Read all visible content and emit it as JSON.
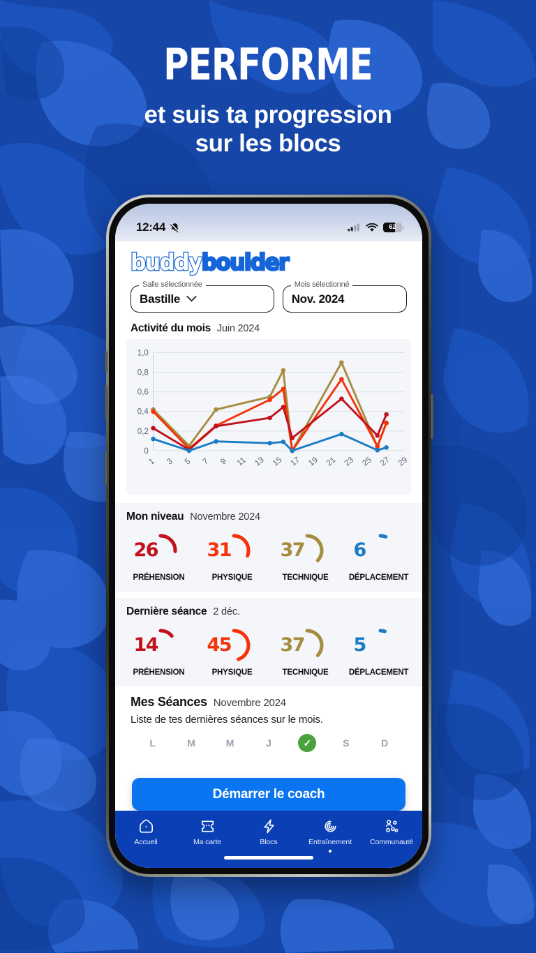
{
  "promo": {
    "headline": "PERFORME",
    "subhead_line1": "et suis ta progression",
    "subhead_line2": "sur les blocs",
    "background_color": "#1546a8"
  },
  "status_bar": {
    "time": "12:44",
    "bell_icon": "bell-muted-icon",
    "cellular_icon": "cellular-signal-icon",
    "wifi_icon": "wifi-icon",
    "battery_percent": "62"
  },
  "app": {
    "logo_part1": "buddy",
    "logo_part2": "boulder",
    "brand_color": "#1565d8",
    "selectors": [
      {
        "label": "Salle sélectionnée",
        "value": "Bastille",
        "has_chevron": true
      },
      {
        "label": "Mois sélectionné",
        "value": "Nov. 2024",
        "has_chevron": false
      }
    ],
    "activity": {
      "title": "Activité du mois",
      "subtitle": "Juin 2024"
    },
    "level": {
      "title": "Mon niveau",
      "subtitle": "Novembre 2024",
      "metrics": [
        {
          "label": "PRÉHENSION",
          "value": "26",
          "color": "#c1121c",
          "pct": 26
        },
        {
          "label": "PHYSIQUE",
          "value": "31",
          "color": "#f53209",
          "pct": 31
        },
        {
          "label": "TECHNIQUE",
          "value": "37",
          "color": "#a68c3f",
          "pct": 37
        },
        {
          "label": "DÉPLACEMENT",
          "value": "6",
          "color": "#1a7cc4",
          "pct": 6
        }
      ]
    },
    "last_session": {
      "title": "Dernière séance",
      "subtitle": "2 déc.",
      "metrics": [
        {
          "label": "PRÉHENSION",
          "value": "14",
          "color": "#c1121c",
          "pct": 14
        },
        {
          "label": "PHYSIQUE",
          "value": "45",
          "color": "#f53209",
          "pct": 45
        },
        {
          "label": "TECHNIQUE",
          "value": "37",
          "color": "#a68c3f",
          "pct": 37
        },
        {
          "label": "DÉPLACEMENT",
          "value": "5",
          "color": "#1a7cc4",
          "pct": 5
        }
      ]
    },
    "sessions": {
      "title": "Mes Séances",
      "subtitle": "Novembre 2024",
      "description": "Liste de tes dernières séances sur le mois.",
      "weekdays": [
        {
          "letter": "L",
          "done": false
        },
        {
          "letter": "M",
          "done": false
        },
        {
          "letter": "M",
          "done": false
        },
        {
          "letter": "J",
          "done": false
        },
        {
          "letter": "✓",
          "done": true
        },
        {
          "letter": "S",
          "done": false
        },
        {
          "letter": "D",
          "done": false
        }
      ]
    },
    "cta_label": "Démarrer le coach",
    "cta_color": "#0b74f0",
    "nav": {
      "background_color": "#0b3fb5",
      "items": [
        {
          "label": "Accueil",
          "icon": "home-icon"
        },
        {
          "label": "Ma carte",
          "icon": "card-icon"
        },
        {
          "label": "Blocs",
          "icon": "bolt-icon"
        },
        {
          "label": "Entraînement",
          "icon": "spiral-icon",
          "active": true
        },
        {
          "label": "Communauté",
          "icon": "community-icon"
        }
      ]
    }
  },
  "chart_data": {
    "type": "line",
    "title": "Activité du mois",
    "subtitle": "Juin 2024",
    "xlabel": "",
    "ylabel": "",
    "ylim": [
      0,
      1.0
    ],
    "yticks": [
      "0",
      "0,2",
      "0,4",
      "0,6",
      "0,8",
      "1,0"
    ],
    "grid": true,
    "legend_position": "none",
    "x": [
      1,
      5,
      8,
      14,
      15.5,
      16.5,
      22,
      26,
      27
    ],
    "xticks": [
      "1",
      "3",
      "5",
      "7",
      "9",
      "11",
      "13",
      "15",
      "17",
      "19",
      "21",
      "23",
      "25",
      "27",
      "29"
    ],
    "xlim": [
      1,
      29
    ],
    "series": [
      {
        "name": "Technique",
        "color": "#a68c3f",
        "values": [
          0.42,
          0.05,
          0.42,
          0.55,
          0.82,
          0.0,
          0.9,
          0.04,
          0.28
        ]
      },
      {
        "name": "Physique",
        "color": "#f53209",
        "values": [
          0.4,
          0.02,
          0.255,
          0.52,
          0.63,
          0.0,
          0.73,
          0.045,
          0.285
        ]
      },
      {
        "name": "Préhension",
        "color": "#c1121c",
        "values": [
          0.23,
          0.01,
          0.25,
          0.335,
          0.445,
          0.13,
          0.53,
          0.155,
          0.37
        ]
      },
      {
        "name": "Déplacement",
        "color": "#1a7cc4",
        "values": [
          0.12,
          0.0,
          0.095,
          0.077,
          0.09,
          0.0,
          0.17,
          0.005,
          0.033
        ]
      }
    ]
  }
}
